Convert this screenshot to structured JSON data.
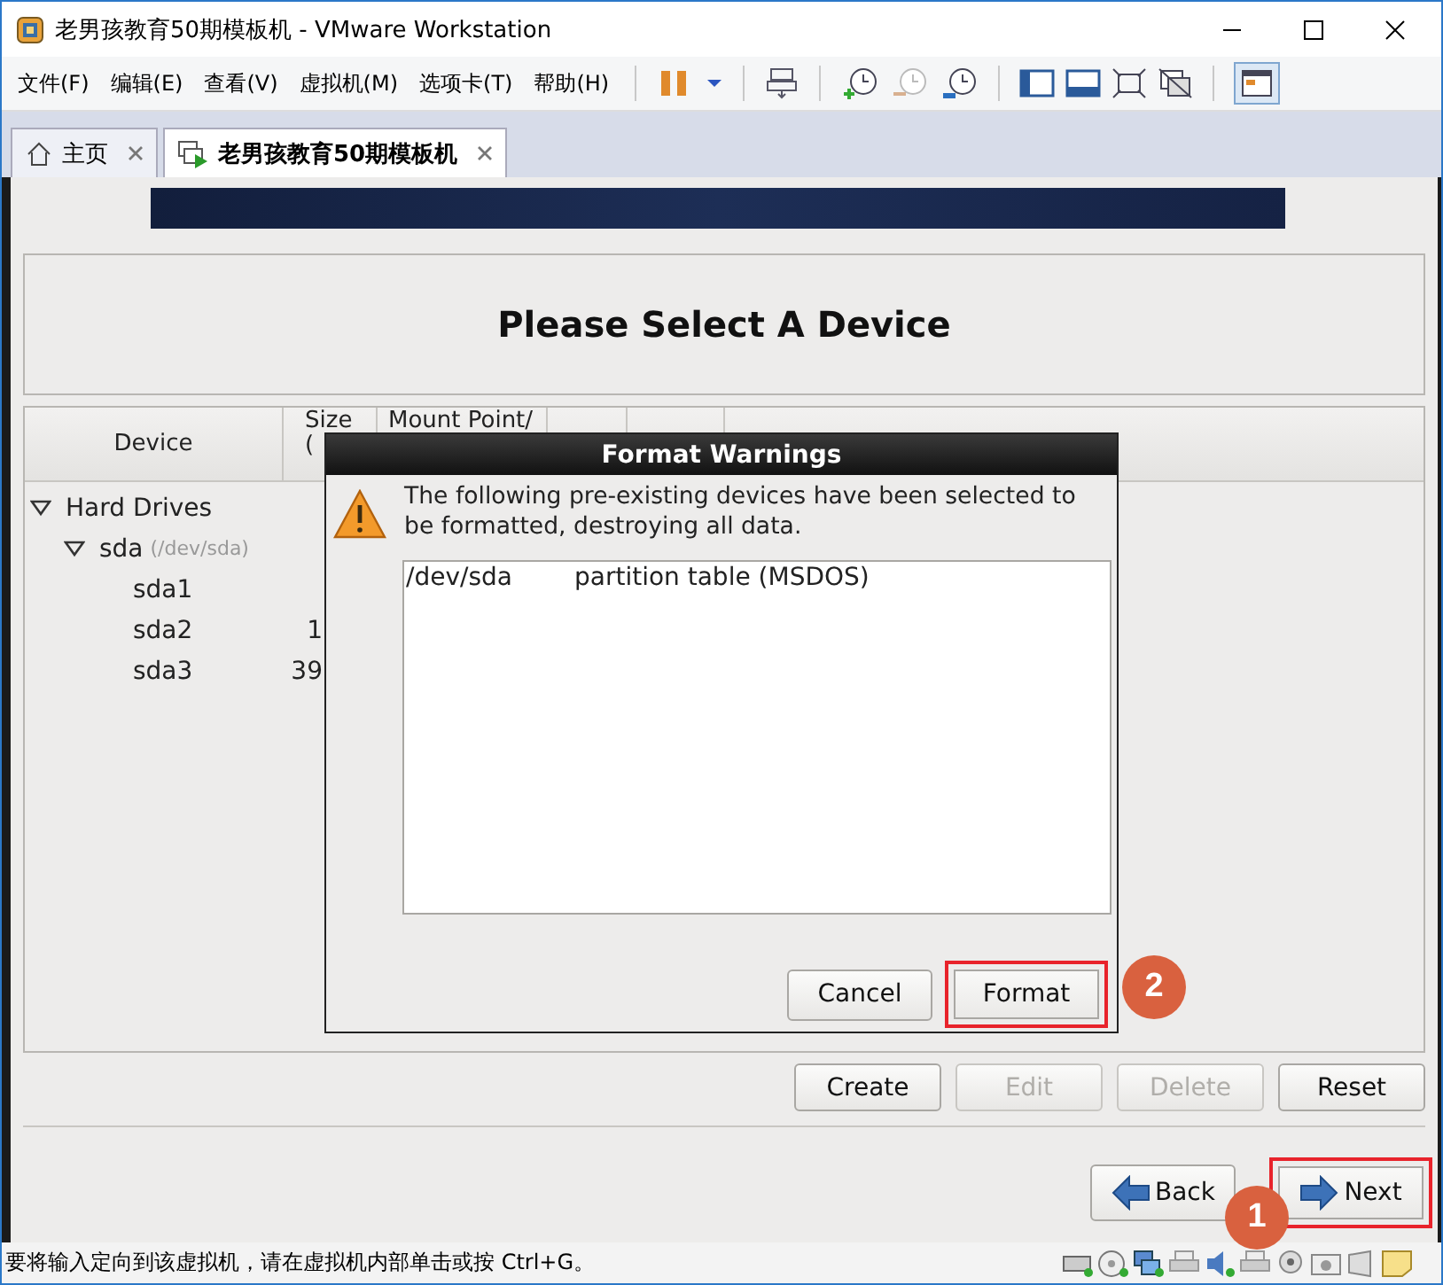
{
  "window": {
    "title": "老男孩教育50期模板机 - VMware Workstation"
  },
  "menu": [
    "文件(F)",
    "编辑(E)",
    "查看(V)",
    "虚拟机(M)",
    "选项卡(T)",
    "帮助(H)"
  ],
  "tabs": [
    {
      "label": "主页",
      "selected": false,
      "kind": "home"
    },
    {
      "label": "老男孩教育50期模板机",
      "selected": true,
      "kind": "vm"
    }
  ],
  "installer": {
    "heading": "Please Select A Device",
    "columns": [
      {
        "lines": [
          "Device"
        ]
      },
      {
        "lines": [
          "Size",
          "("
        ]
      },
      {
        "lines": [
          "Mount Point/"
        ]
      }
    ],
    "tree": [
      {
        "label": "Hard Drives",
        "expanded": true,
        "children": [
          {
            "label": "sda",
            "detail": "(/dev/sda)",
            "expanded": true,
            "children": [
              {
                "label": "sda1"
              },
              {
                "label": "sda2",
                "size": "1"
              },
              {
                "label": "sda3",
                "size": "39"
              }
            ]
          }
        ]
      }
    ],
    "actions": [
      {
        "label": "Create",
        "disabled": false
      },
      {
        "label": "Edit",
        "disabled": true
      },
      {
        "label": "Delete",
        "disabled": true
      },
      {
        "label": "Reset",
        "disabled": false
      }
    ],
    "nav": [
      {
        "label": "Back",
        "kind": "back",
        "highlighted": false
      },
      {
        "label": "Next",
        "kind": "next",
        "highlighted": true,
        "step": "1"
      }
    ]
  },
  "dialog": {
    "title": "Format Warnings",
    "message": "The following pre-existing devices have been selected to be formatted, destroying all data.",
    "devices": [
      {
        "device": "/dev/sda",
        "description": "partition table (MSDOS)"
      }
    ],
    "buttons": [
      {
        "label": "Cancel",
        "highlighted": false
      },
      {
        "label": "Format",
        "highlighted": true,
        "step": "2"
      }
    ]
  },
  "status_bar": {
    "message": "要将输入定向到该虚拟机，请在虚拟机内部单击或按 Ctrl+G。"
  }
}
